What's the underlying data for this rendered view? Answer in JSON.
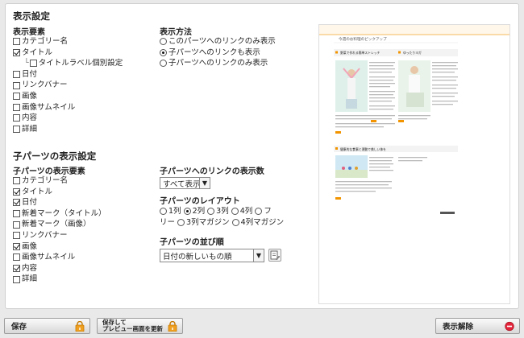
{
  "display_settings": {
    "title": "表示設定",
    "elements_heading": "表示要素",
    "elements": [
      {
        "label": "カテゴリー名",
        "checked": false
      },
      {
        "label": "タイトル",
        "checked": true
      },
      {
        "label": "タイトルラベル個別設定",
        "checked": false,
        "sub": true
      },
      {
        "label": "日付",
        "checked": false
      },
      {
        "label": "リンクバナー",
        "checked": false
      },
      {
        "label": "画像",
        "checked": false
      },
      {
        "label": "画像サムネイル",
        "checked": false
      },
      {
        "label": "内容",
        "checked": false
      },
      {
        "label": "詳細",
        "checked": false
      }
    ],
    "method_heading": "表示方法",
    "methods": [
      {
        "label": "このパーツへのリンクのみ表示",
        "selected": false
      },
      {
        "label": "子パーツへのリンクも表示",
        "selected": true
      },
      {
        "label": "子パーツへのリンクのみ表示",
        "selected": false
      }
    ]
  },
  "child_settings": {
    "title": "子パーツの表示設定",
    "elements_heading": "子パーツの表示要素",
    "elements": [
      {
        "label": "カテゴリー名",
        "checked": false
      },
      {
        "label": "タイトル",
        "checked": true
      },
      {
        "label": "日付",
        "checked": true
      },
      {
        "label": "新着マーク（タイトル）",
        "checked": false
      },
      {
        "label": "新着マーク（画像）",
        "checked": false
      },
      {
        "label": "リンクバナー",
        "checked": false
      },
      {
        "label": "画像",
        "checked": true
      },
      {
        "label": "画像サムネイル",
        "checked": false
      },
      {
        "label": "内容",
        "checked": true
      },
      {
        "label": "詳細",
        "checked": false
      }
    ],
    "link_count_heading": "子パーツへのリンクの表示数",
    "link_count_value": "すべて表示",
    "layout_heading": "子パーツのレイアウト",
    "layouts": [
      {
        "label": "1列",
        "selected": false
      },
      {
        "label": "2列",
        "selected": true
      },
      {
        "label": "3列",
        "selected": false
      },
      {
        "label": "4列",
        "selected": false
      }
    ],
    "layouts_line2": [
      {
        "label": "3列マガジン",
        "selected": false
      },
      {
        "label": "4列マガジン",
        "selected": false
      }
    ],
    "layout_wrap_a": "フ",
    "layout_wrap_b": "リー",
    "sort_heading": "子パーツの並び順",
    "sort_value": "日付の新しいもの順"
  },
  "preview": {
    "page_title": "今週のお料理のピックアップ",
    "article1_title": "野菜で作れる簡単ストレッチ",
    "article2_title": "ゆったりヨガ",
    "article3_title": "健康的な食事と運動で美しい体を",
    "accent_color": "#f29400"
  },
  "footer": {
    "save_label": "保存",
    "save_preview_line1": "保存して",
    "save_preview_line2": "プレビュー画面を更新",
    "hide_label": "表示解除"
  }
}
